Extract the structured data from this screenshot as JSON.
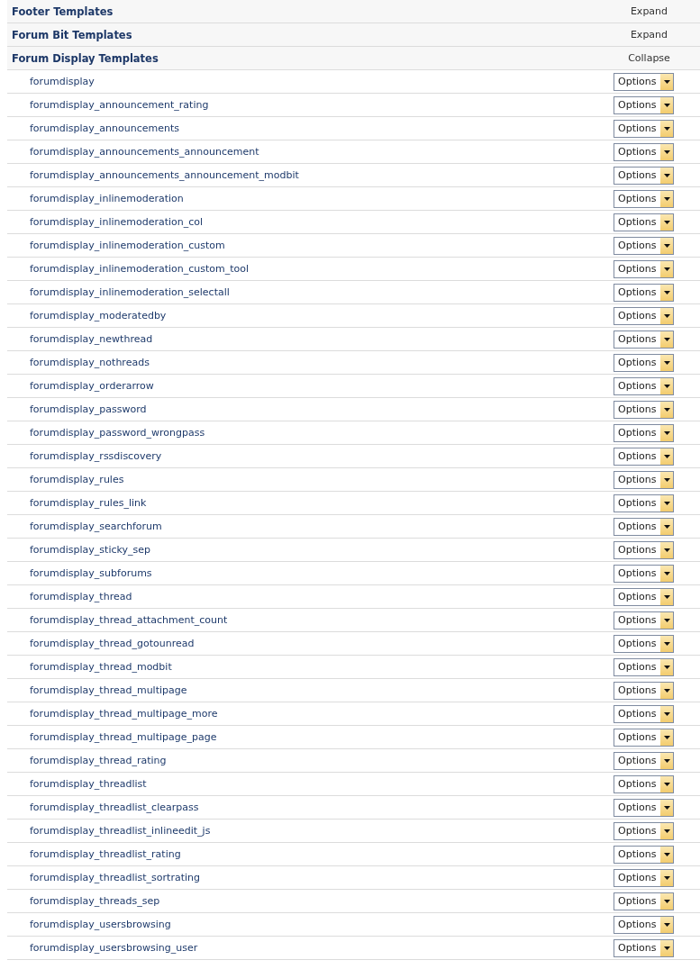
{
  "groups": [
    {
      "title": "Footer Templates",
      "toggle": "Expand"
    },
    {
      "title": "Forum Bit Templates",
      "toggle": "Expand"
    },
    {
      "title": "Forum Display Templates",
      "toggle": "Collapse",
      "templates": [
        {
          "name": "forumdisplay",
          "action": "Options"
        },
        {
          "name": "forumdisplay_announcement_rating",
          "action": "Options"
        },
        {
          "name": "forumdisplay_announcements",
          "action": "Options"
        },
        {
          "name": "forumdisplay_announcements_announcement",
          "action": "Options"
        },
        {
          "name": "forumdisplay_announcements_announcement_modbit",
          "action": "Options"
        },
        {
          "name": "forumdisplay_inlinemoderation",
          "action": "Options"
        },
        {
          "name": "forumdisplay_inlinemoderation_col",
          "action": "Options"
        },
        {
          "name": "forumdisplay_inlinemoderation_custom",
          "action": "Options"
        },
        {
          "name": "forumdisplay_inlinemoderation_custom_tool",
          "action": "Options"
        },
        {
          "name": "forumdisplay_inlinemoderation_selectall",
          "action": "Options"
        },
        {
          "name": "forumdisplay_moderatedby",
          "action": "Options"
        },
        {
          "name": "forumdisplay_newthread",
          "action": "Options"
        },
        {
          "name": "forumdisplay_nothreads",
          "action": "Options"
        },
        {
          "name": "forumdisplay_orderarrow",
          "action": "Options"
        },
        {
          "name": "forumdisplay_password",
          "action": "Options"
        },
        {
          "name": "forumdisplay_password_wrongpass",
          "action": "Options"
        },
        {
          "name": "forumdisplay_rssdiscovery",
          "action": "Options"
        },
        {
          "name": "forumdisplay_rules",
          "action": "Options"
        },
        {
          "name": "forumdisplay_rules_link",
          "action": "Options"
        },
        {
          "name": "forumdisplay_searchforum",
          "action": "Options"
        },
        {
          "name": "forumdisplay_sticky_sep",
          "action": "Options"
        },
        {
          "name": "forumdisplay_subforums",
          "action": "Options"
        },
        {
          "name": "forumdisplay_thread",
          "action": "Options"
        },
        {
          "name": "forumdisplay_thread_attachment_count",
          "action": "Options"
        },
        {
          "name": "forumdisplay_thread_gotounread",
          "action": "Options"
        },
        {
          "name": "forumdisplay_thread_modbit",
          "action": "Options"
        },
        {
          "name": "forumdisplay_thread_multipage",
          "action": "Options"
        },
        {
          "name": "forumdisplay_thread_multipage_more",
          "action": "Options"
        },
        {
          "name": "forumdisplay_thread_multipage_page",
          "action": "Options"
        },
        {
          "name": "forumdisplay_thread_rating",
          "action": "Options"
        },
        {
          "name": "forumdisplay_threadlist",
          "action": "Options"
        },
        {
          "name": "forumdisplay_threadlist_clearpass",
          "action": "Options"
        },
        {
          "name": "forumdisplay_threadlist_inlineedit_js",
          "action": "Options"
        },
        {
          "name": "forumdisplay_threadlist_rating",
          "action": "Options"
        },
        {
          "name": "forumdisplay_threadlist_sortrating",
          "action": "Options"
        },
        {
          "name": "forumdisplay_threads_sep",
          "action": "Options"
        },
        {
          "name": "forumdisplay_usersbrowsing",
          "action": "Options"
        },
        {
          "name": "forumdisplay_usersbrowsing_user",
          "action": "Options"
        }
      ]
    }
  ]
}
